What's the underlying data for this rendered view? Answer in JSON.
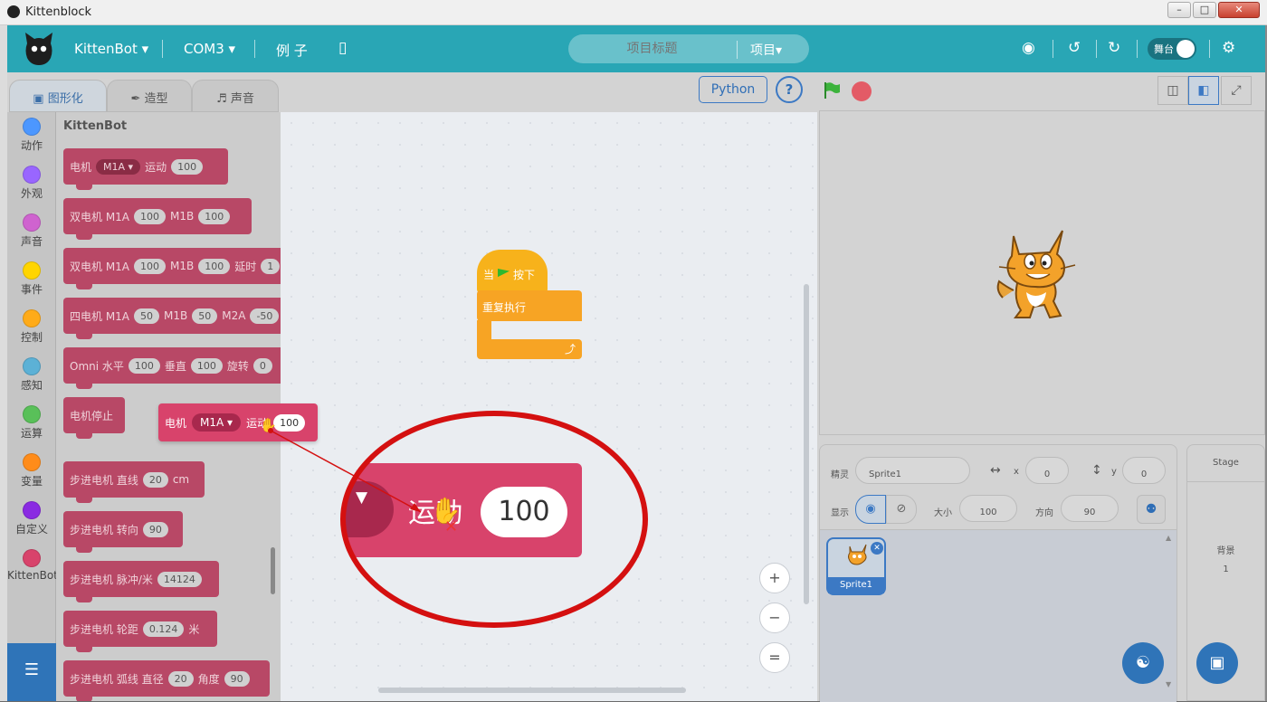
{
  "window": {
    "title": "Kittenblock",
    "minimize": "–",
    "maximize": "□",
    "close": "✕"
  },
  "menubar": {
    "brand": "KittenBot ▾",
    "port": "COM3 ▾",
    "examples": "例 子",
    "project_title_placeholder": "项目标题",
    "project_menu": "项目▾",
    "stage_toggle": "舞台",
    "accent_color": "#29a6b5"
  },
  "tabs": [
    {
      "label": "图形化",
      "icon": "code-icon"
    },
    {
      "label": "造型",
      "icon": "brush-icon"
    },
    {
      "label": "声音",
      "icon": "speaker-icon"
    }
  ],
  "categories": [
    {
      "label": "动作",
      "color": "#4c97ff"
    },
    {
      "label": "外观",
      "color": "#9966ff"
    },
    {
      "label": "声音",
      "color": "#cf63cf"
    },
    {
      "label": "事件",
      "color": "#ffd500"
    },
    {
      "label": "控制",
      "color": "#ffab19"
    },
    {
      "label": "感知",
      "color": "#5cb1d6"
    },
    {
      "label": "运算",
      "color": "#59c059"
    },
    {
      "label": "变量",
      "color": "#ff8c1a"
    },
    {
      "label": "自定义",
      "color": "#8a2be2"
    },
    {
      "label": "KittenBot",
      "color": "#d8436b"
    }
  ],
  "palette": {
    "heading": "KittenBot",
    "blocks": [
      {
        "parts": [
          "电机",
          "M1A ▾",
          "运动",
          "100"
        ]
      },
      {
        "parts": [
          "双电机 M1A",
          "100",
          "M1B",
          "100"
        ]
      },
      {
        "parts": [
          "双电机 M1A",
          "100",
          "M1B",
          "100",
          "延时",
          "1"
        ]
      },
      {
        "parts": [
          "四电机 M1A",
          "50",
          "M1B",
          "50",
          "M2A",
          "-50"
        ]
      },
      {
        "parts": [
          "Omni 水平",
          "100",
          "垂直",
          "100",
          "旋转",
          "0"
        ]
      },
      {
        "parts": [
          "电机停止"
        ]
      },
      {
        "parts": [
          "步进电机 直线",
          "20",
          "cm"
        ]
      },
      {
        "parts": [
          "步进电机 转向",
          "90"
        ]
      },
      {
        "parts": [
          "步进电机 脉冲/米",
          "14124"
        ]
      },
      {
        "parts": [
          "步进电机 轮距",
          "0.124",
          "米"
        ]
      },
      {
        "parts": [
          "步进电机 弧线 直径",
          "20",
          "角度",
          "90"
        ]
      }
    ]
  },
  "workspace": {
    "python_button": "Python",
    "help_button": "?",
    "hat_block": {
      "prefix": "当",
      "suffix": "按下"
    },
    "forever_block": {
      "label": "重复执行",
      "arrow": "⤴"
    },
    "dragged_block": {
      "label": "电机",
      "dropdown": "M1A ▾",
      "action": "运动",
      "value": "100"
    },
    "magnifier": {
      "caret": "▼",
      "label": "运动",
      "value": "100"
    },
    "zoom_in": "+",
    "zoom_out": "−",
    "zoom_reset": "="
  },
  "sprite_info": {
    "sprite_label": "精灵",
    "sprite_name": "Sprite1",
    "x_label": "x",
    "x_value": "0",
    "y_label": "y",
    "y_value": "0",
    "show_label": "显示",
    "size_label": "大小",
    "size_value": "100",
    "direction_label": "方向",
    "direction_value": "90"
  },
  "sprites": [
    {
      "name": "Sprite1"
    }
  ],
  "stage_pane": {
    "title": "Stage",
    "backdrop_label": "背景",
    "backdrop_count": "1"
  }
}
